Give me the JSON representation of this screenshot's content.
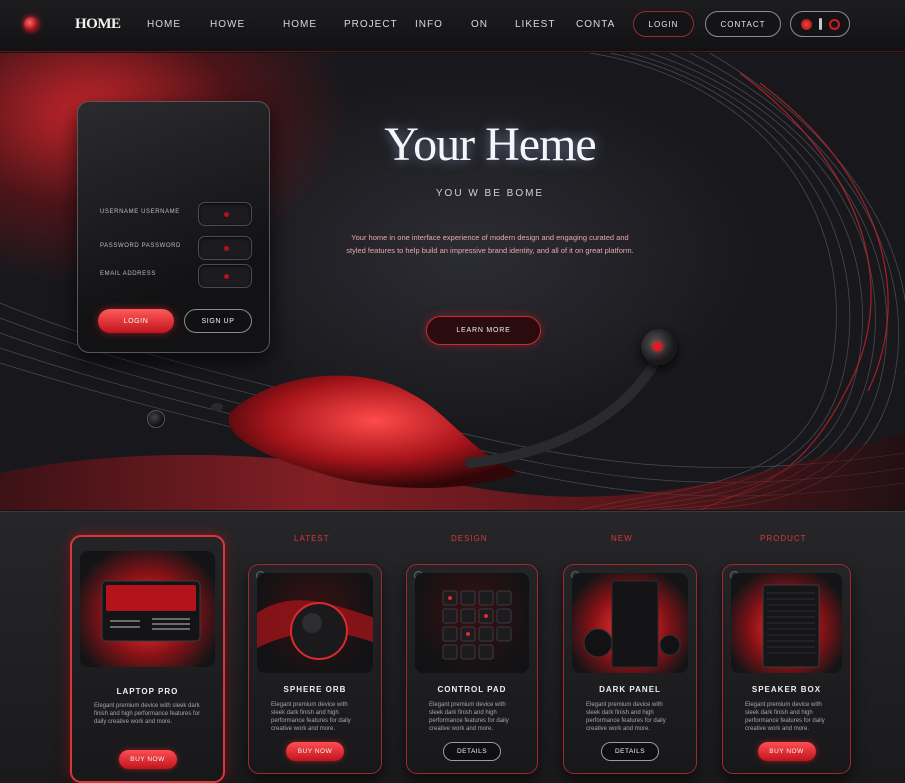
{
  "nav": {
    "logo": "HOME",
    "links": [
      "HOME",
      "HOWE",
      "HOME",
      "PROJECT",
      "INFO",
      "ON",
      "LIKEST",
      "CONTA"
    ],
    "button_1": "LOGIN",
    "button_2": "CONTACT",
    "icons": [
      "red-dot-icon",
      "menu-icon",
      "ring-icon"
    ]
  },
  "login_card": {
    "fields": [
      {
        "label": "USERNAME USERNAME"
      },
      {
        "label": "PASSWORD PASSWORD"
      },
      {
        "label": "EMAIL ADDRESS"
      }
    ],
    "primary_button": "LOGIN",
    "secondary_button": "SIGN UP"
  },
  "hero": {
    "title": "Your Heme",
    "subtitle": "YOU W BE BOME",
    "body": "Your home in one interface experience of modern design and engaging curated and styled features to help build an impressive brand identity, and all of it on great platform.",
    "cta": "LEARN MORE"
  },
  "categories": [
    "LATEST",
    "DESIGN",
    "NEW",
    "PRODUCT"
  ],
  "products": [
    {
      "name": "LAPTOP PRO",
      "desc": "Elegant premium device with sleek dark finish and high performance features for daily creative work and more.",
      "button": "BUY NOW",
      "style": "red"
    },
    {
      "name": "SPHERE ORB",
      "desc": "Elegant premium device with sleek dark finish and high performance features for daily creative work and more.",
      "button": "BUY NOW",
      "style": "red"
    },
    {
      "name": "CONTROL PAD",
      "desc": "Elegant premium device with sleek dark finish and high performance features for daily creative work and more.",
      "button": "DETAILS",
      "style": "dark"
    },
    {
      "name": "DARK PANEL",
      "desc": "Elegant premium device with sleek dark finish and high performance features for daily creative work and more.",
      "button": "DETAILS",
      "style": "dark"
    },
    {
      "name": "SPEAKER BOX",
      "desc": "Elegant premium device with sleek dark finish and high performance features for daily creative work and more.",
      "button": "BUY NOW",
      "style": "red"
    }
  ],
  "colors": {
    "accent": "#d9363c",
    "background": "#141416"
  }
}
